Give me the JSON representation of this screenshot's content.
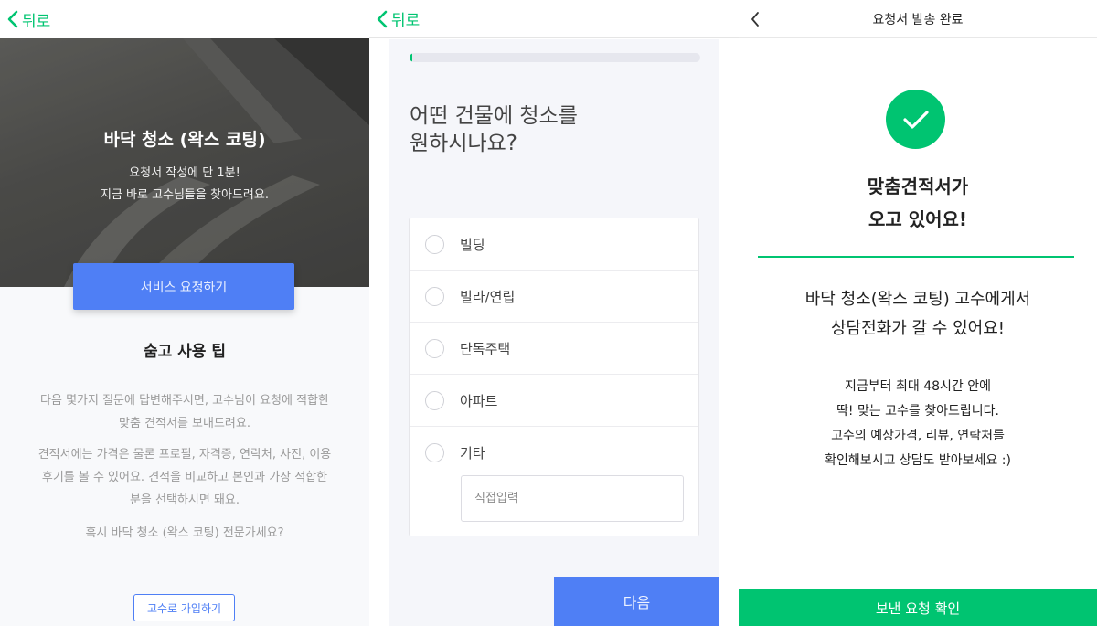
{
  "colors": {
    "brand_green": "#00c471",
    "primary_blue": "#4f7ff5",
    "muted_text": "#9a9a9a"
  },
  "screen1": {
    "back_label": "뒤로",
    "hero": {
      "title": "바닥 청소 (왁스 코팅)",
      "sub_line1": "요청서 작성에 단 1분!",
      "sub_line2": "지금 바로 고수님들을 찾아드려요."
    },
    "cta_label": "서비스 요청하기",
    "tips_title": "숨고 사용 팁",
    "tips_p1_line1": "다음 몇가지 질문에 답변해주시면, 고수님이 요청에 적합한",
    "tips_p1_line2": "맞춤 견적서를 보내드려요.",
    "tips_p2_line1": "견적서에는 가격은 물론 프로필, 자격증, 연락처, 사진, 이용",
    "tips_p2_line2": "후기를 볼 수 있어요. 견적을 비교하고 본인과 가장 적합한",
    "tips_p2_line3": "분을 선택하시면 돼요.",
    "tips_p3": "혹시 바닥 청소 (왁스 코팅) 전문가세요?",
    "join_label": "고수로 가입하기"
  },
  "screen2": {
    "back_label": "뒤로",
    "progress_fraction": 0.01,
    "question_line1": "어떤 건물에 청소를",
    "question_line2": "원하시나요?",
    "options": [
      {
        "label": "빌딩"
      },
      {
        "label": "빌라/연립"
      },
      {
        "label": "단독주택"
      },
      {
        "label": "아파트"
      },
      {
        "label": "기타"
      }
    ],
    "custom_placeholder": "직접입력",
    "next_label": "다음"
  },
  "screen3": {
    "title": "요청서 발송 완료",
    "headline_line1": "맞춤견적서가",
    "headline_line2": "오고 있어요!",
    "mid_line1": "바닥 청소(왁스 코팅) 고수에게서",
    "mid_line2": "상담전화가 갈 수 있어요!",
    "info_line1": "지금부터 최대 48시간 안에",
    "info_line2": "딱! 맞는 고수를 찾아드립니다.",
    "info_line3": "고수의 예상가격, 리뷰, 연락처를",
    "info_line4": "확인해보시고 상담도 받아보세요 :)",
    "confirm_label": "보낸 요청 확인"
  }
}
